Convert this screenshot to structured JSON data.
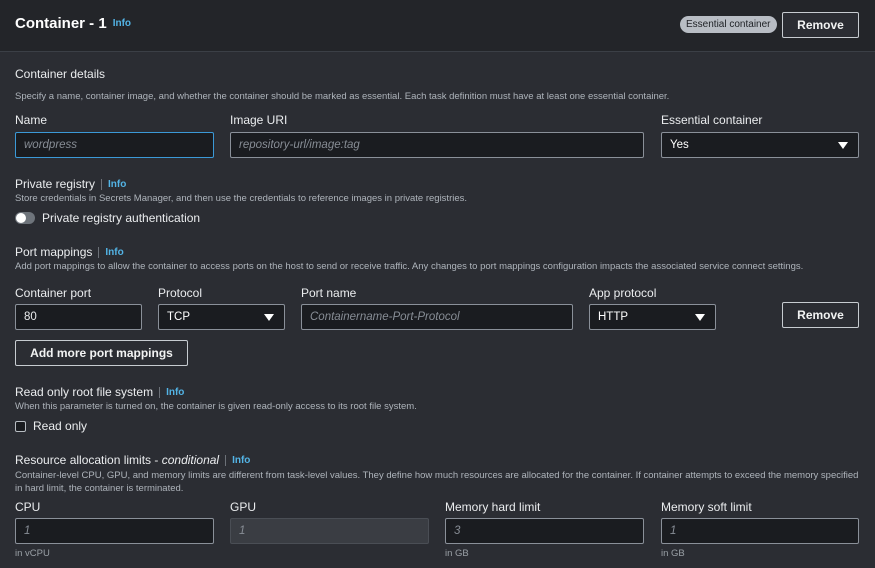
{
  "header": {
    "title": "Container - 1",
    "info": "Info",
    "essential_badge": "Essential container",
    "remove_label": "Remove"
  },
  "details": {
    "heading": "Container details",
    "description": "Specify a name, container image, and whether the container should be marked as essential. Each task definition must have at least one essential container.",
    "name_label": "Name",
    "name_placeholder": "wordpress",
    "image_label": "Image URI",
    "image_placeholder": "repository-url/image:tag",
    "essential_label": "Essential container",
    "essential_value": "Yes"
  },
  "private_registry": {
    "heading": "Private registry",
    "info": "Info",
    "description": "Store credentials in Secrets Manager, and then use the credentials to reference images in private registries.",
    "toggle_label": "Private registry authentication"
  },
  "port_mappings": {
    "heading": "Port mappings",
    "info": "Info",
    "description": "Add port mappings to allow the container to access ports on the host to send or receive traffic. Any changes to port mappings configuration impacts the associated service connect settings.",
    "container_port_label": "Container port",
    "container_port_value": "80",
    "protocol_label": "Protocol",
    "protocol_value": "TCP",
    "port_name_label": "Port name",
    "port_name_placeholder": "Containername-Port-Protocol",
    "app_protocol_label": "App protocol",
    "app_protocol_value": "HTTP",
    "remove_label": "Remove",
    "add_label": "Add more port mappings"
  },
  "read_only": {
    "heading": "Read only root file system",
    "info": "Info",
    "description": "When this parameter is turned on, the container is given read-only access to its root file system.",
    "checkbox_label": "Read only"
  },
  "resources": {
    "heading": "Resource allocation limits - ",
    "heading_em": "conditional",
    "info": "Info",
    "description": "Container-level CPU, GPU, and memory limits are different from task-level values. They define how much resources are allocated for the container. If container attempts to exceed the memory specified in hard limit, the container is terminated.",
    "cpu_label": "CPU",
    "cpu_placeholder": "1",
    "cpu_help": "in vCPU",
    "gpu_label": "GPU",
    "gpu_placeholder": "1",
    "mem_hard_label": "Memory hard limit",
    "mem_hard_placeholder": "3",
    "mem_hard_help": "in GB",
    "mem_soft_label": "Memory soft limit",
    "mem_soft_placeholder": "1",
    "mem_soft_help": "in GB"
  }
}
